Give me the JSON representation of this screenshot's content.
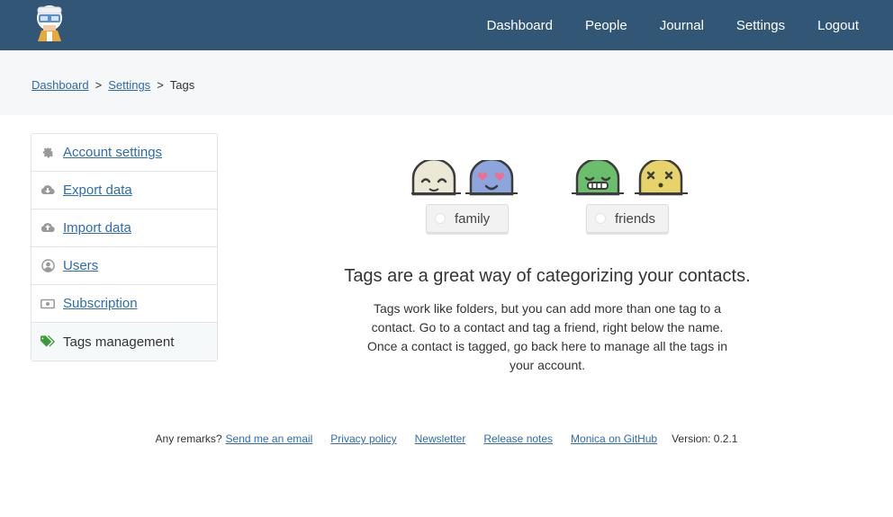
{
  "header": {
    "logo": "monica-logo",
    "nav": [
      "Dashboard",
      "People",
      "Journal",
      "Settings",
      "Logout"
    ]
  },
  "breadcrumb": {
    "items": [
      "Dashboard",
      "Settings",
      "Tags"
    ],
    "separator": ">"
  },
  "sidebar": {
    "items": [
      {
        "label": "Account settings",
        "icon": "gear-icon",
        "active": false
      },
      {
        "label": "Export data",
        "icon": "cloud-download-icon",
        "active": false
      },
      {
        "label": "Import data",
        "icon": "cloud-upload-icon",
        "active": false
      },
      {
        "label": "Users",
        "icon": "user-circle-icon",
        "active": false
      },
      {
        "label": "Subscription",
        "icon": "money-icon",
        "active": false
      },
      {
        "label": "Tags management",
        "icon": "tags-icon",
        "active": true
      }
    ]
  },
  "main": {
    "tags": [
      "family",
      "friends"
    ],
    "headline": "Tags are a great way of categorizing your contacts.",
    "description": "Tags work like folders, but you can add more than one tag to a contact. Go to a contact and tag a friend, right below the name. Once a contact is tagged, go back here to manage all the tags in your account."
  },
  "footer": {
    "remarks": "Any remarks?",
    "links": [
      "Send me an email",
      "Privacy policy",
      "Newsletter",
      "Release notes",
      "Monica on GitHub"
    ],
    "version": "Version: 0.2.1"
  },
  "colors": {
    "header_bg": "#325776",
    "link": "#2d6cb2",
    "face_beige": "#ece8d6",
    "face_blue": "#8ca6dd",
    "face_green": "#6bbf6c",
    "face_yellow": "#e8d26a",
    "tag_icon": "#3c9a3c"
  }
}
